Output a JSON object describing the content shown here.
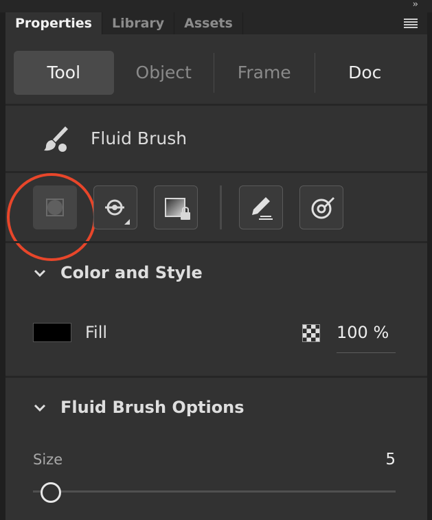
{
  "panel_tabs": [
    {
      "label": "Properties",
      "active": true
    },
    {
      "label": "Library",
      "active": false
    },
    {
      "label": "Assets",
      "active": false
    }
  ],
  "segments": [
    {
      "label": "Tool",
      "active": true
    },
    {
      "label": "Object",
      "active": false
    },
    {
      "label": "Frame",
      "active": false
    },
    {
      "label": "Doc",
      "active": false
    }
  ],
  "tool": {
    "name": "Fluid Brush",
    "icon": "brush-icon"
  },
  "tool_buttons": [
    {
      "icon": "brush-shape-icon",
      "highlighted": true
    },
    {
      "icon": "brush-mode-icon",
      "has_dropdown": true
    },
    {
      "icon": "lock-fill-icon"
    },
    {
      "icon": "pressure-icon"
    },
    {
      "icon": "tilt-icon"
    }
  ],
  "color_style": {
    "title": "Color and Style",
    "fill_label": "Fill",
    "fill_color": "#000000",
    "alpha": "100 %"
  },
  "brush_options": {
    "title": "Fluid Brush Options",
    "size_label": "Size",
    "size_value": "5",
    "size_fraction": 0.03
  },
  "colors": {
    "highlight": "#e8462a",
    "panel": "#323232",
    "active_segment": "#4a4a4a"
  }
}
